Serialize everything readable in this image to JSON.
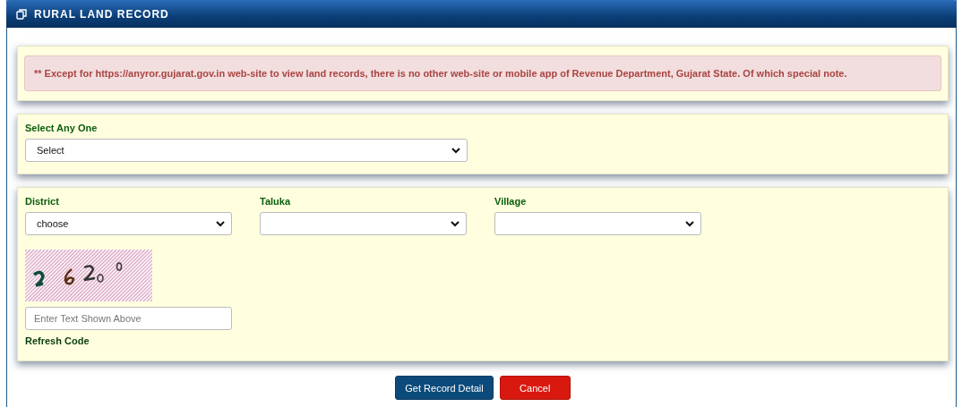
{
  "panel": {
    "title": "RURAL LAND RECORD"
  },
  "notice": "** Except for https://anyror.gujarat.gov.in web-site to view land records, there is no other web-site or mobile app of Revenue Department, Gujarat State. Of which special note.",
  "selector": {
    "label": "Select Any One",
    "value": "Select"
  },
  "location_fields": [
    {
      "label": "District",
      "value": "choose"
    },
    {
      "label": "Taluka"
    },
    {
      "label": "Village"
    }
  ],
  "captcha": {
    "kind": "picture",
    "placeholder": "Enter Text Shown Above",
    "refresh_link": "Refresh Code"
  },
  "buttons": [
    {
      "label": "Get Record Detail",
      "kind": "primary"
    },
    {
      "label": "Cancel",
      "kind": "danger"
    }
  ]
}
